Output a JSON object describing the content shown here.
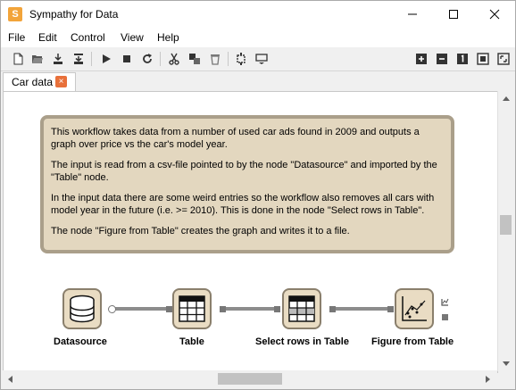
{
  "window": {
    "title": "Sympathy for Data",
    "app_icon_glyph": "S",
    "controls": [
      "minimize-icon",
      "maximize-icon",
      "close-icon"
    ]
  },
  "menu": {
    "items": [
      "File",
      "Edit",
      "Control",
      "View",
      "Help"
    ]
  },
  "toolbar": {
    "left_icons": [
      "new-file-icon",
      "open-folder-icon",
      "save-icon",
      "save-as-icon",
      "run-icon",
      "stop-icon",
      "reload-icon",
      "cut-icon",
      "copy-icon",
      "delete-icon",
      "insert-node-icon",
      "subflow-icon"
    ],
    "right_icons": [
      "zoom-in-icon",
      "zoom-out-icon",
      "zoom-reset-icon",
      "zoom-fit-icon",
      "zoom-selection-icon"
    ]
  },
  "tabs": [
    {
      "label": "Car data",
      "close_glyph": "×"
    }
  ],
  "note": {
    "paragraphs": [
      "This workflow takes data from a number of used car ads found in 2009 and outputs a graph over price vs the car's model year.",
      "The input is read from a csv-file pointed to by the node \"Datasource\" and imported by the \"Table\" node.",
      "In the input data there are some weird entries so the workflow also removes all cars with model year in the future (i.e. >= 2010). This is done in the node \"Select rows in Table\".",
      "The node \"Figure from Table\" creates the graph and writes it to a file."
    ]
  },
  "nodes": [
    {
      "label": "Datasource",
      "icon": "database-icon"
    },
    {
      "label": "Table",
      "icon": "table-icon"
    },
    {
      "label": "Select rows in Table",
      "icon": "select-rows-icon"
    },
    {
      "label": "Figure from Table",
      "icon": "scatter-plot-icon"
    }
  ],
  "colors": {
    "note_bg": "#e3d7bf",
    "note_border": "#aa9f8a",
    "node_bg": "#e9dcc3",
    "node_border": "#8a7f6c",
    "tab_close": "#e8703a",
    "app_icon": "#f2a43a"
  }
}
